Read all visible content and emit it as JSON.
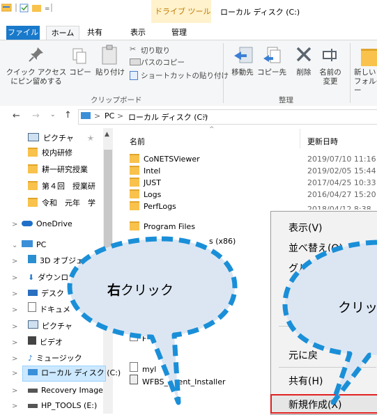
{
  "titlebar": {
    "context_tab_label": "ドライブ ツール",
    "window_title": "ローカル ディスク (C:)"
  },
  "ribbon_tabs": {
    "file": "ファイル",
    "home": "ホーム",
    "share": "共有",
    "view": "表示",
    "manage": "管理"
  },
  "ribbon": {
    "pin_quick_access": "クイック アクセス\nにピン留めする",
    "copy": "コピー",
    "paste": "貼り付け",
    "cut": "切り取り",
    "copy_path": "パスのコピー",
    "paste_shortcut": "ショートカットの貼り付け",
    "clipboard_group": "クリップボード",
    "move_to": "移動先",
    "copy_to": "コピー先",
    "delete": "削除",
    "rename": "名前の\n変更",
    "organize_group": "整理",
    "new_folder": "新しい\nフォルダー"
  },
  "address": {
    "crumbs": [
      "PC",
      "ローカル ディスク (C:)"
    ],
    "sep": ">"
  },
  "nav": {
    "quick": [
      {
        "label": "ピクチャ"
      },
      {
        "label": "校内研修"
      },
      {
        "label": "耕一研究授業"
      },
      {
        "label": "第４回　授業研"
      },
      {
        "label": "令和　元年　学"
      }
    ],
    "onedrive": "OneDrive",
    "pc": "PC",
    "pc_items": [
      {
        "label": "3D オブジェ"
      },
      {
        "label": "ダウンロ"
      },
      {
        "label": "デスク"
      },
      {
        "label": "ドキュメ"
      },
      {
        "label": "ピクチャ"
      },
      {
        "label": "ビデオ"
      },
      {
        "label": "ミュージック"
      },
      {
        "label": "ローカル ディスク (C:)"
      },
      {
        "label": "Recovery Image"
      },
      {
        "label": "HP_TOOLS (E:)"
      }
    ]
  },
  "filelist": {
    "col_name": "名前",
    "col_date": "更新日時",
    "items": [
      {
        "name": "CoNETSViewer",
        "date": "2019/07/10 11:16"
      },
      {
        "name": "Intel",
        "date": "2019/02/05 15:44"
      },
      {
        "name": "JUST",
        "date": "2017/04/25 10:33"
      },
      {
        "name": "Logs",
        "date": "2016/04/27 15:20"
      },
      {
        "name": "PerfLogs",
        "date": "2018/04/12 8:38"
      },
      {
        "name": "Program Files",
        "date": ""
      },
      {
        "name": "s (x86)",
        "date": ""
      }
    ],
    "lower_items": [
      {
        "name": "F"
      },
      {
        "name": "myl"
      },
      {
        "name": "WFBS_Agent_Installer"
      }
    ]
  },
  "context_menu": {
    "view": "表示(V)",
    "sort": "並べ替え(O)",
    "group": "グル",
    "undo": "元に戻",
    "share": "共有(H)",
    "new": "新規作成(X)"
  },
  "bubbles": {
    "left_bold": "右",
    "left_rest": "クリック",
    "right": "クリッ"
  },
  "colors": {
    "accent": "#1979ca",
    "bubble_fill": "#dce6f2",
    "bubble_stroke": "#1a8fd8",
    "highlight": "#e02020"
  }
}
